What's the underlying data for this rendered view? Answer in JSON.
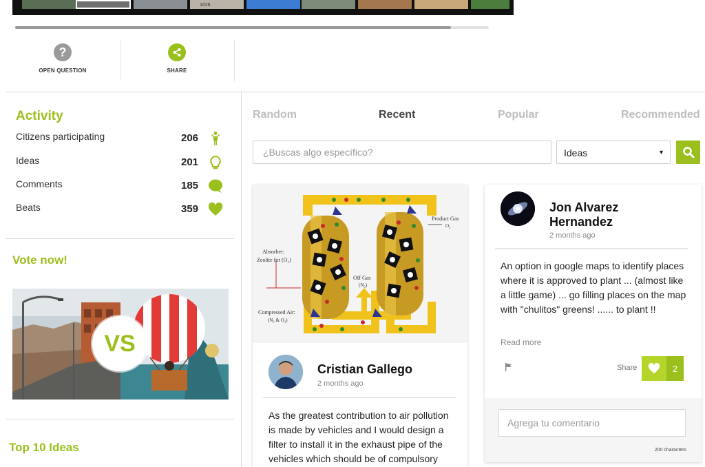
{
  "actions": {
    "open_question": "OPEN QUESTION",
    "share": "SHARE"
  },
  "gallery": {
    "year_text": "1626",
    "progress_percent": 92
  },
  "activity": {
    "title": "Activity",
    "rows": [
      {
        "label": "Citizens participating",
        "value": "206",
        "icon": "person-icon"
      },
      {
        "label": "Ideas",
        "value": "201",
        "icon": "lightbulb-icon"
      },
      {
        "label": "Comments",
        "value": "185",
        "icon": "comment-bubble-icon"
      },
      {
        "label": "Beats",
        "value": "359",
        "icon": "heart-icon"
      }
    ]
  },
  "vote": {
    "title": "Vote now!",
    "vs_label": "VS"
  },
  "top_ideas": {
    "title": "Top 10 Ideas"
  },
  "tabs": [
    {
      "label": "Random",
      "active": false
    },
    {
      "label": "Recent",
      "active": true
    },
    {
      "label": "Popular",
      "active": false
    },
    {
      "label": "Recommended",
      "active": false
    }
  ],
  "search": {
    "placeholder": "¿Buscas algo específico?",
    "filter_value": "Ideas"
  },
  "diagram": {
    "product_gas_label": "Product Gas",
    "product_gas_formula": "O₂",
    "absorber_label": "Absorber:",
    "absorber_label2": "Zeolite for (O₂)",
    "off_gas_label": "Off Gas",
    "off_gas_formula": "(N₂)",
    "compressed_air_label": "Compressed Air:",
    "compressed_air_formula": "(N₂ & O₂)"
  },
  "card1": {
    "author": "Cristian Gallego",
    "time": "2 months ago",
    "text": "As the greatest contribution to air pollution is made by vehicles and I would design a filter to install it in the exhaust pipe of the vehicles which should be of compulsory"
  },
  "card2": {
    "author_line1": "Jon Alvarez",
    "author_line2": "Hernandez",
    "time": "2 months ago",
    "text": "An option in google maps to identify places where it is approved to plant ... (almost like a little game) ... go filling places on the map with \"chulitos\" greens! ...... to plant !!",
    "read_more": "Read more",
    "share_label": "Share",
    "likes": "2",
    "comment_placeholder": "Agrega tu comentario",
    "chars_label": "200 characters"
  },
  "colors": {
    "accent": "#9bbf1c",
    "accent_light": "#b5d52b",
    "tab_inactive": "#bdbdbd"
  }
}
